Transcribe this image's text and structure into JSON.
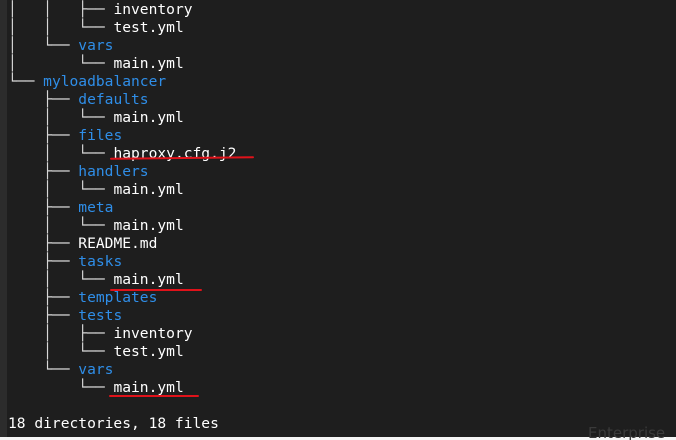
{
  "tree_lines": [
    {
      "prefix": "│   │   ├── ",
      "name": "inventory",
      "kind": "file"
    },
    {
      "prefix": "│   │   └── ",
      "name": "test.yml",
      "kind": "file"
    },
    {
      "prefix": "│   └── ",
      "name": "vars",
      "kind": "dir"
    },
    {
      "prefix": "│       └── ",
      "name": "main.yml",
      "kind": "file"
    },
    {
      "prefix": "└── ",
      "name": "myloadbalancer",
      "kind": "dir"
    },
    {
      "prefix": "    ├── ",
      "name": "defaults",
      "kind": "dir"
    },
    {
      "prefix": "    │   └── ",
      "name": "main.yml",
      "kind": "file"
    },
    {
      "prefix": "    ├── ",
      "name": "files",
      "kind": "dir"
    },
    {
      "prefix": "    │   └── ",
      "name": "haproxy.cfg.j2",
      "kind": "file"
    },
    {
      "prefix": "    ├── ",
      "name": "handlers",
      "kind": "dir"
    },
    {
      "prefix": "    │   └── ",
      "name": "main.yml",
      "kind": "file"
    },
    {
      "prefix": "    ├── ",
      "name": "meta",
      "kind": "dir"
    },
    {
      "prefix": "    │   └── ",
      "name": "main.yml",
      "kind": "file"
    },
    {
      "prefix": "    ├── ",
      "name": "README.md",
      "kind": "file"
    },
    {
      "prefix": "    ├── ",
      "name": "tasks",
      "kind": "dir"
    },
    {
      "prefix": "    │   └── ",
      "name": "main.yml",
      "kind": "file"
    },
    {
      "prefix": "    ├── ",
      "name": "templates",
      "kind": "dir"
    },
    {
      "prefix": "    ├── ",
      "name": "tests",
      "kind": "dir"
    },
    {
      "prefix": "    │   ├── ",
      "name": "inventory",
      "kind": "file"
    },
    {
      "prefix": "    │   └── ",
      "name": "test.yml",
      "kind": "file"
    },
    {
      "prefix": "    └── ",
      "name": "vars",
      "kind": "dir"
    },
    {
      "prefix": "        └── ",
      "name": "main.yml",
      "kind": "file"
    }
  ],
  "summary": "18 directories, 18 files",
  "watermark": "Enterprise",
  "colors": {
    "background": "#1e1e1e",
    "directory": "#2f8ee8",
    "file": "#ffffff",
    "annotation": "#e0121a"
  }
}
